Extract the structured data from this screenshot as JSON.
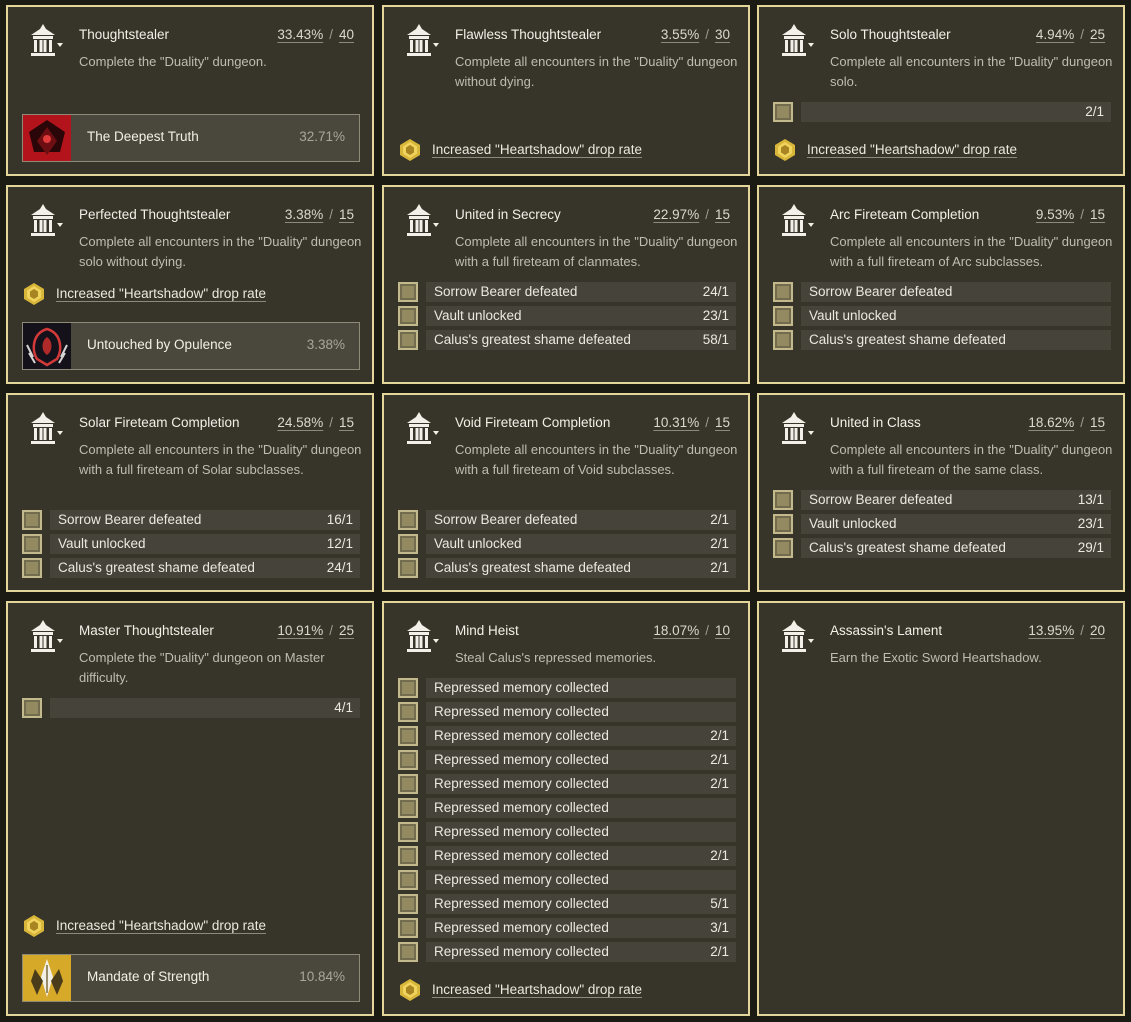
{
  "triumphs": [
    {
      "title": "Thoughtstealer",
      "percent": "33.43%",
      "points": "40",
      "description": "Complete the \"Duality\" dungeon.",
      "seal": {
        "name": "The Deepest Truth",
        "percent": "32.71%",
        "icon": "deepest-truth-emblem"
      }
    },
    {
      "title": "Flawless Thoughtstealer",
      "percent": "3.55%",
      "points": "30",
      "description": "Complete all encounters in the \"Duality\" dungeon without dying.",
      "reward": {
        "label": "Increased \"Heartshadow\" drop rate",
        "icon": "engram-icon"
      }
    },
    {
      "title": "Solo Thoughtstealer",
      "percent": "4.94%",
      "points": "25",
      "description": "Complete all encounters in the \"Duality\" dungeon solo.",
      "objectives": [
        {
          "label": "",
          "count": "2/1"
        }
      ],
      "reward": {
        "label": "Increased \"Heartshadow\" drop rate",
        "icon": "engram-icon"
      }
    },
    {
      "title": "Perfected Thoughtstealer",
      "percent": "3.38%",
      "points": "15",
      "description": "Complete all encounters in the \"Duality\" dungeon solo without dying.",
      "reward": {
        "label": "Increased \"Heartshadow\" drop rate",
        "icon": "engram-icon"
      },
      "seal": {
        "name": "Untouched by Opulence",
        "percent": "3.38%",
        "icon": "opulence-emblem"
      }
    },
    {
      "title": "United in Secrecy",
      "percent": "22.97%",
      "points": "15",
      "description": "Complete all encounters in the \"Duality\" dungeon with a full fireteam of clanmates.",
      "objectives": [
        {
          "label": "Sorrow Bearer defeated",
          "count": "24/1"
        },
        {
          "label": "Vault unlocked",
          "count": "23/1"
        },
        {
          "label": "Calus's greatest shame defeated",
          "count": "58/1"
        }
      ]
    },
    {
      "title": "Arc Fireteam Completion",
      "percent": "9.53%",
      "points": "15",
      "description": "Complete all encounters in the \"Duality\" dungeon with a full fireteam of Arc subclasses.",
      "objectives": [
        {
          "label": "Sorrow Bearer defeated",
          "count": ""
        },
        {
          "label": "Vault unlocked",
          "count": ""
        },
        {
          "label": "Calus's greatest shame defeated",
          "count": ""
        }
      ]
    },
    {
      "title": "Solar Fireteam Completion",
      "percent": "24.58%",
      "points": "15",
      "description": "Complete all encounters in the \"Duality\" dungeon with a full fireteam of Solar subclasses.",
      "objectives": [
        {
          "label": "Sorrow Bearer defeated",
          "count": "16/1"
        },
        {
          "label": "Vault unlocked",
          "count": "12/1"
        },
        {
          "label": "Calus's greatest shame defeated",
          "count": "24/1"
        }
      ]
    },
    {
      "title": "Void Fireteam Completion",
      "percent": "10.31%",
      "points": "15",
      "description": "Complete all encounters in the \"Duality\" dungeon with a full fireteam of Void subclasses.",
      "objectives": [
        {
          "label": "Sorrow Bearer defeated",
          "count": "2/1"
        },
        {
          "label": "Vault unlocked",
          "count": "2/1"
        },
        {
          "label": "Calus's greatest shame defeated",
          "count": "2/1"
        }
      ]
    },
    {
      "title": "United in Class",
      "percent": "18.62%",
      "points": "15",
      "description": "Complete all encounters in the \"Duality\" dungeon with a full fireteam of the same class.",
      "objectives": [
        {
          "label": "Sorrow Bearer defeated",
          "count": "13/1"
        },
        {
          "label": "Vault unlocked",
          "count": "23/1"
        },
        {
          "label": "Calus's greatest shame defeated",
          "count": "29/1"
        }
      ]
    },
    {
      "title": "Master Thoughtstealer",
      "percent": "10.91%",
      "points": "25",
      "description": "Complete the \"Duality\" dungeon on Master difficulty.",
      "objectives": [
        {
          "label": "",
          "count": "4/1"
        }
      ],
      "reward": {
        "label": "Increased \"Heartshadow\" drop rate",
        "icon": "engram-icon"
      },
      "seal": {
        "name": "Mandate of Strength",
        "percent": "10.84%",
        "icon": "mandate-emblem"
      }
    },
    {
      "title": "Mind Heist",
      "percent": "18.07%",
      "points": "10",
      "description": "Steal Calus's repressed memories.",
      "objectives": [
        {
          "label": "Repressed memory collected",
          "count": ""
        },
        {
          "label": "Repressed memory collected",
          "count": ""
        },
        {
          "label": "Repressed memory collected",
          "count": "2/1"
        },
        {
          "label": "Repressed memory collected",
          "count": "2/1"
        },
        {
          "label": "Repressed memory collected",
          "count": "2/1"
        },
        {
          "label": "Repressed memory collected",
          "count": ""
        },
        {
          "label": "Repressed memory collected",
          "count": ""
        },
        {
          "label": "Repressed memory collected",
          "count": "2/1"
        },
        {
          "label": "Repressed memory collected",
          "count": ""
        },
        {
          "label": "Repressed memory collected",
          "count": "5/1"
        },
        {
          "label": "Repressed memory collected",
          "count": "3/1"
        },
        {
          "label": "Repressed memory collected",
          "count": "2/1"
        }
      ],
      "reward": {
        "label": "Increased \"Heartshadow\" drop rate",
        "icon": "engram-icon"
      }
    },
    {
      "title": "Assassin's Lament",
      "percent": "13.95%",
      "points": "20",
      "description": "Earn the Exotic Sword Heartshadow."
    }
  ],
  "separator": "/",
  "colors": {
    "card_border": "#e4d69a",
    "card_bg": "#37342a",
    "page_bg": "#1b1a13",
    "checkbox": "#948a61",
    "engram_gold": "#d8b63a"
  },
  "icons": {
    "triumph": "duality-shrine-icon",
    "checkbox": "objective-checkbox",
    "reward": "engram-icon"
  }
}
